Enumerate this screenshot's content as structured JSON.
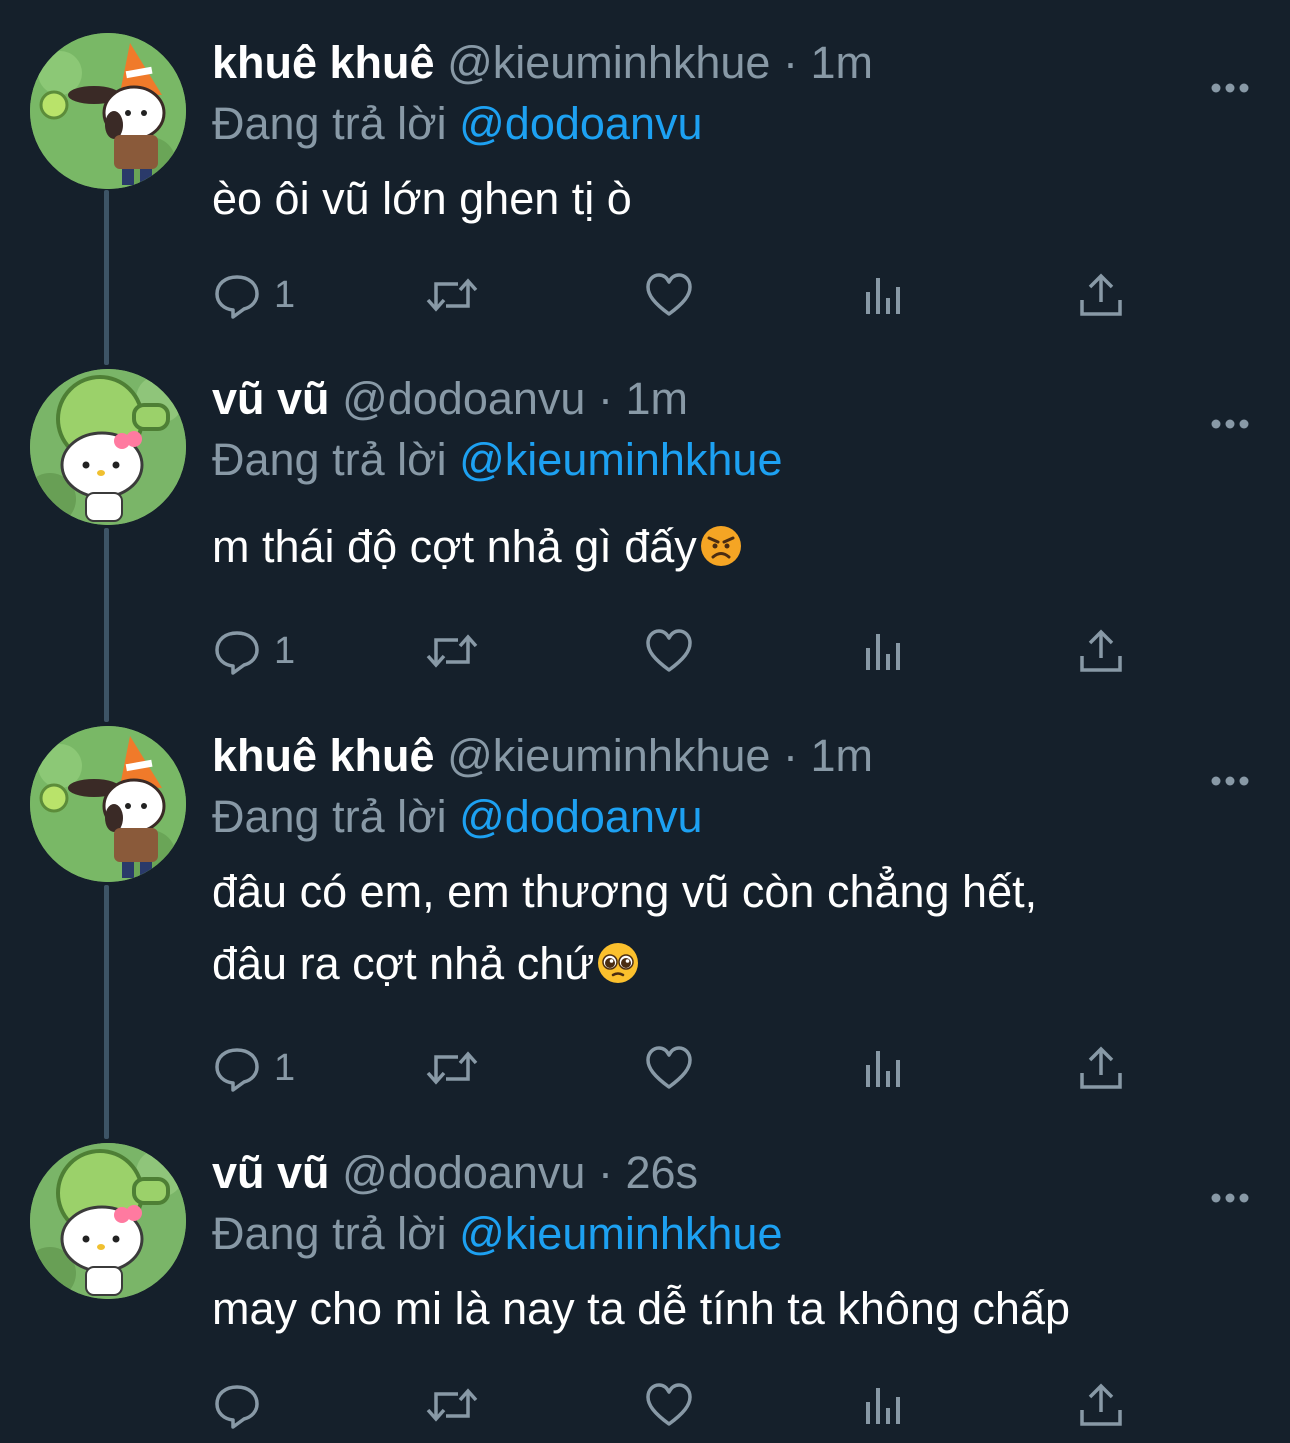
{
  "tweets": [
    {
      "name": "khuê khuê",
      "handle": "@kieuminhkhue",
      "separator": "·",
      "time": "1m",
      "reply_prefix": "Đang trả lời",
      "reply_to": "@dodoanvu",
      "lines": [
        "èo ôi vũ lớn ghen tị ò"
      ],
      "reply_count": "1"
    },
    {
      "name": "vũ vũ",
      "handle": "@dodoanvu",
      "separator": "·",
      "time": "1m",
      "reply_prefix": "Đang trả lời",
      "reply_to": "@kieuminhkhue",
      "lines": [
        "m thái độ cợt nhả gì đấy"
      ],
      "reply_count": "1"
    },
    {
      "name": "khuê khuê",
      "handle": "@kieuminhkhue",
      "separator": "·",
      "time": "1m",
      "reply_prefix": "Đang trả lời",
      "reply_to": "@dodoanvu",
      "lines": [
        "đâu có em, em thương vũ còn chẳng hết,",
        "đâu ra cợt nhả chứ"
      ],
      "reply_count": "1"
    },
    {
      "name": "vũ vũ",
      "handle": "@dodoanvu",
      "separator": "·",
      "time": "26s",
      "reply_prefix": "Đang trả lời",
      "reply_to": "@kieuminhkhue",
      "lines": [
        "may cho mi là nay ta dễ tính ta không chấp"
      ],
      "reply_count": ""
    }
  ],
  "icons": {
    "reply": "speech-bubble-icon",
    "retweet": "retweet-arrows-icon",
    "like": "heart-icon",
    "analytics": "bar-chart-icon",
    "share": "share-upload-icon",
    "more": "more-dots-icon",
    "emoji_angry": "angry-face-emoji",
    "emoji_pleading": "pleading-face-emoji"
  },
  "colors": {
    "background": "#15202b",
    "text": "#ffffff",
    "secondary": "#8899a6",
    "link": "#1da1f2",
    "thread_line": "#3d5466"
  }
}
